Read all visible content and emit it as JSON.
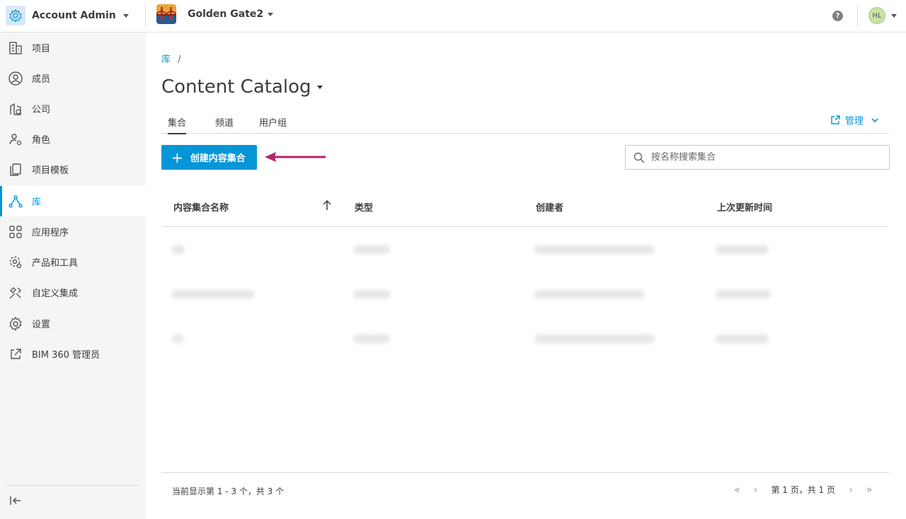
{
  "topbar": {
    "app_title": "Account Admin",
    "project_name": "Golden Gate2",
    "help_label": "?",
    "user_initials": "HL"
  },
  "sidebar": {
    "items": [
      {
        "label": "项目",
        "icon": "building-icon"
      },
      {
        "label": "成员",
        "icon": "user-circle-icon"
      },
      {
        "label": "公司",
        "icon": "company-icon"
      },
      {
        "label": "角色",
        "icon": "role-icon"
      },
      {
        "label": "项目模板",
        "icon": "template-icon"
      },
      {
        "label": "库",
        "icon": "library-icon",
        "active": true
      },
      {
        "label": "应用程序",
        "icon": "apps-grid-icon"
      },
      {
        "label": "产品和工具",
        "icon": "tools-gear-icon"
      },
      {
        "label": "自定义集成",
        "icon": "integration-icon"
      },
      {
        "label": "设置",
        "icon": "gear-icon"
      },
      {
        "label": "BIM 360 管理员",
        "icon": "external-link-icon"
      }
    ]
  },
  "main": {
    "breadcrumb_link": "库",
    "breadcrumb_sep": "/",
    "title": "Content Catalog",
    "tabs": [
      {
        "label": "集合",
        "active": true
      },
      {
        "label": "频道"
      },
      {
        "label": "用户组"
      }
    ],
    "manage_label": "管理",
    "create_button": "创建内容集合",
    "search_placeholder": "按名称搜索集合",
    "columns": [
      "内容集合名称",
      "类型",
      "创建者",
      "上次更新时间"
    ],
    "footer_text": "当前显示第 1 - 3 个，共 3 个",
    "page_info": "第 1 页，共 1 页"
  },
  "colors": {
    "accent": "#0696d7",
    "annotation_arrow": "#b5246a",
    "sidebar_bg": "#f5f5f5"
  }
}
